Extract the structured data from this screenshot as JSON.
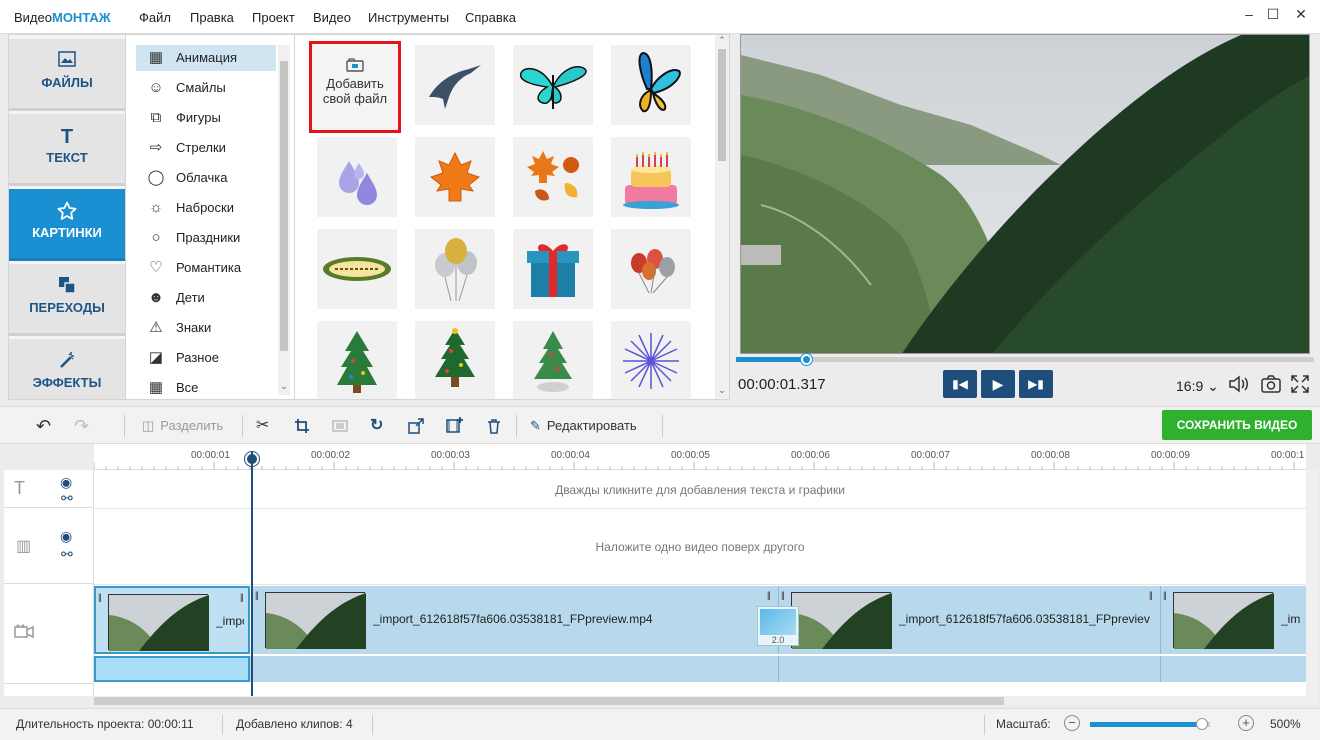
{
  "app": {
    "logo_part1": "Видео",
    "logo_part2": "МОНТАЖ"
  },
  "menu": [
    "Файл",
    "Правка",
    "Проект",
    "Видео",
    "Инструменты",
    "Справка"
  ],
  "window_controls": {
    "minimize": "–",
    "maximize": "☐",
    "close": "✕"
  },
  "left_tabs": [
    {
      "label": "ФАЙЛЫ",
      "icon": "image-icon"
    },
    {
      "label": "ТЕКСТ",
      "icon": "text-icon"
    },
    {
      "label": "КАРТИНКИ",
      "icon": "star-icon",
      "active": true
    },
    {
      "label": "ПЕРЕХОДЫ",
      "icon": "transition-icon"
    },
    {
      "label": "ЭФФЕКТЫ",
      "icon": "magic-wand-icon"
    }
  ],
  "categories": [
    {
      "label": "Анимация",
      "icon": "film-icon",
      "active": true
    },
    {
      "label": "Смайлы",
      "icon": "smiley-icon"
    },
    {
      "label": "Фигуры",
      "icon": "shapes-icon"
    },
    {
      "label": "Стрелки",
      "icon": "arrow-icon"
    },
    {
      "label": "Облачка",
      "icon": "speech-bubble-icon"
    },
    {
      "label": "Наброски",
      "icon": "sun-sketch-icon"
    },
    {
      "label": "Праздники",
      "icon": "balloon-icon"
    },
    {
      "label": "Романтика",
      "icon": "heart-icon"
    },
    {
      "label": "Дети",
      "icon": "baby-icon"
    },
    {
      "label": "Знаки",
      "icon": "warning-icon"
    },
    {
      "label": "Разное",
      "icon": "misc-icon"
    },
    {
      "label": "Все",
      "icon": "grid-icon"
    }
  ],
  "gallery": {
    "add_file_line1": "Добавить",
    "add_file_line2": "свой файл",
    "items": [
      "swallow",
      "butterfly-cyan",
      "butterfly-blue",
      "water-drops",
      "maple-leaf",
      "autumn-leaves",
      "birthday-cake",
      "congrats-banner",
      "balloons-silver",
      "gift-box",
      "balloons-red",
      "christmas-tree-1",
      "christmas-tree-2",
      "christmas-tree-3",
      "fireworks"
    ]
  },
  "player": {
    "timecode": "00:00:01.317",
    "progress": 0.12,
    "aspect": "16:9 ⌄"
  },
  "toolbar": {
    "split": "Разделить",
    "edit": "Редактировать",
    "save": "СОХРАНИТЬ ВИДЕО"
  },
  "ruler": [
    "00:00:01",
    "00:00:02",
    "00:00:03",
    "00:00:04",
    "00:00:05",
    "00:00:06",
    "00:00:07",
    "00:00:08",
    "00:00:09",
    "00:00:1"
  ],
  "tracks": {
    "text_hint": "Дважды кликните для добавления текста и графики",
    "overlay_hint": "Наложите одно видео поверх другого",
    "clip_name_short": "_impo",
    "clip_name": "_import_612618f57fa606.03538181_FPpreview.mp4",
    "clip_name_cut": "_import_612618f57fa606.03538181_FPpreviev",
    "clip_name_tail": "_im",
    "transition_value": "2.0"
  },
  "status": {
    "duration_label": "Длительность проекта:",
    "duration": "00:00:11",
    "clips_label": "Добавлено клипов:",
    "clips": "4",
    "zoom_label": "Масштаб:",
    "zoom_value": "500%",
    "zoom_level": 0.93
  },
  "colors": {
    "accent": "#1a8fd2",
    "save": "#2fb12f",
    "highlight": "#e8121b"
  }
}
